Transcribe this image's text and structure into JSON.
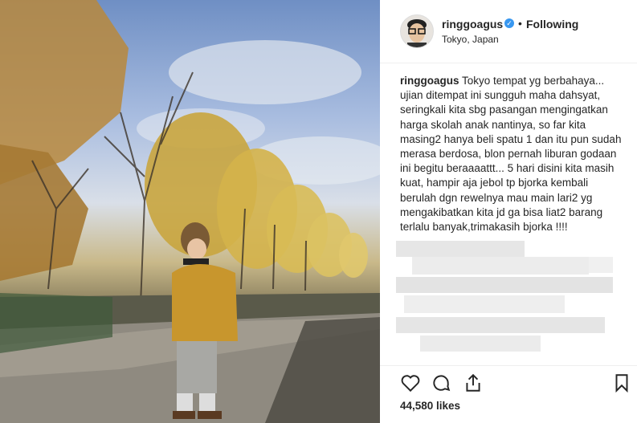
{
  "post": {
    "username": "ringgoagus",
    "follow_state": "Following",
    "separator": "•",
    "location": "Tokyo, Japan",
    "caption_user": "ringgoagus",
    "caption_text": "Tokyo tempat yg berbahaya... ujian ditempat ini sungguh maha dahsyat, seringkali kita sbg pasangan mengingatkan harga skolah anak nantinya, so far kita masing2 hanya beli spatu 1 dan itu pun sudah merasa berdosa, blon pernah liburan godaan ini begitu beraaaattt... 5 hari disini kita masih kuat, hampir aja jebol tp bjorka kembali berulah dgn rewelnya mau main lari2 yg mengakibatkan kita jd ga bisa liat2 barang terlalu banyak,trimakasih bjorka !!!!",
    "likes": "44,580 likes",
    "verified_icon": "verified-badge-icon",
    "colors": {
      "verified": "#3897f0",
      "border": "#efefef",
      "text": "#262626"
    }
  },
  "actions": {
    "like_icon": "heart-icon",
    "comment_icon": "comment-icon",
    "share_icon": "share-icon",
    "save_icon": "bookmark-icon"
  }
}
